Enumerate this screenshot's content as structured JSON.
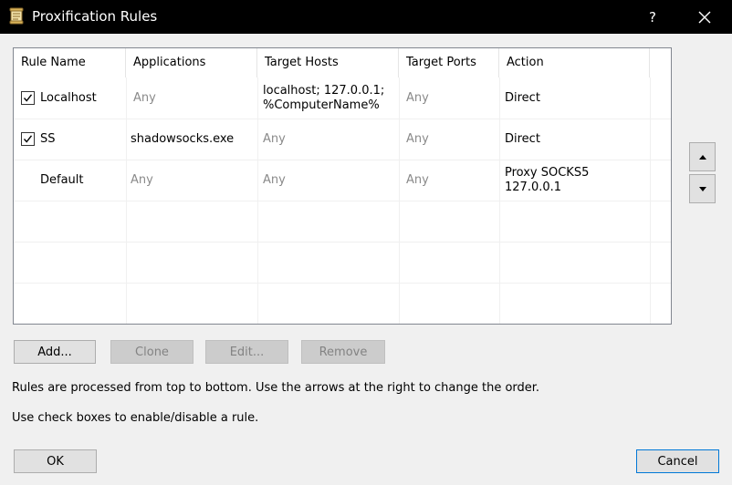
{
  "window": {
    "title": "Proxification Rules",
    "help_glyph": "?"
  },
  "table": {
    "columns": [
      "Rule Name",
      "Applications",
      "Target Hosts",
      "Target Ports",
      "Action"
    ],
    "rows": [
      {
        "checked": true,
        "has_checkbox": true,
        "name": "Localhost",
        "applications": "Any",
        "target_hosts": "localhost; 127.0.0.1;\n%ComputerName%",
        "target_ports": "Any",
        "action": "Direct"
      },
      {
        "checked": true,
        "has_checkbox": true,
        "name": "SS",
        "applications": "shadowsocks.exe",
        "target_hosts": "Any",
        "target_ports": "Any",
        "action": "Direct"
      },
      {
        "checked": false,
        "has_checkbox": false,
        "name": "Default",
        "applications": "Any",
        "target_hosts": "Any",
        "target_ports": "Any",
        "action": "Proxy SOCKS5\n127.0.0.1"
      }
    ]
  },
  "buttons": {
    "add": "Add...",
    "clone": "Clone",
    "edit": "Edit...",
    "remove": "Remove",
    "ok": "OK",
    "cancel": "Cancel"
  },
  "info": {
    "line1": "Rules are processed from top to bottom. Use the arrows at the right to change the order.",
    "line2": "Use check boxes to enable/disable a rule."
  },
  "icons": {
    "app": "scroll-icon",
    "move_up": "triangle-up-icon",
    "move_down": "triangle-down-icon",
    "close": "close-icon"
  },
  "colors": {
    "titlebar": "#000000",
    "muted_text": "#8a8a8a",
    "default_button_border": "#0078d7"
  }
}
